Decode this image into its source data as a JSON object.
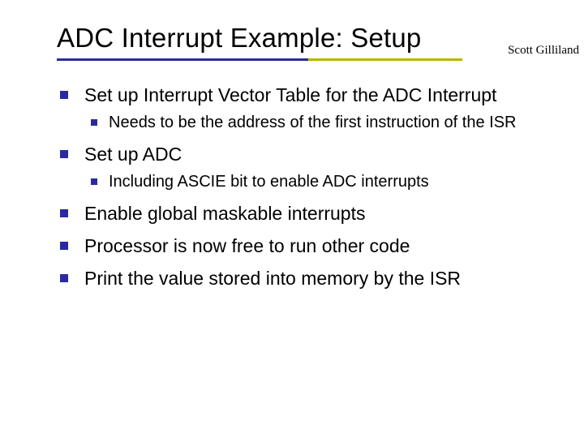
{
  "author": "Scott Gilliland",
  "title": "ADC Interrupt Example: Setup",
  "bullets": {
    "b0": {
      "text": "Set up Interrupt Vector Table for the ADC Interrupt",
      "sub0": "Needs to be the address of the first instruction of the ISR"
    },
    "b1": {
      "text": "Set up ADC",
      "sub0": "Including ASCIE bit to enable ADC interrupts"
    },
    "b2": {
      "text": "Enable global maskable interrupts"
    },
    "b3": {
      "text": "Processor is now free to run other code"
    },
    "b4": {
      "text": "Print the value stored into memory by the ISR"
    }
  }
}
